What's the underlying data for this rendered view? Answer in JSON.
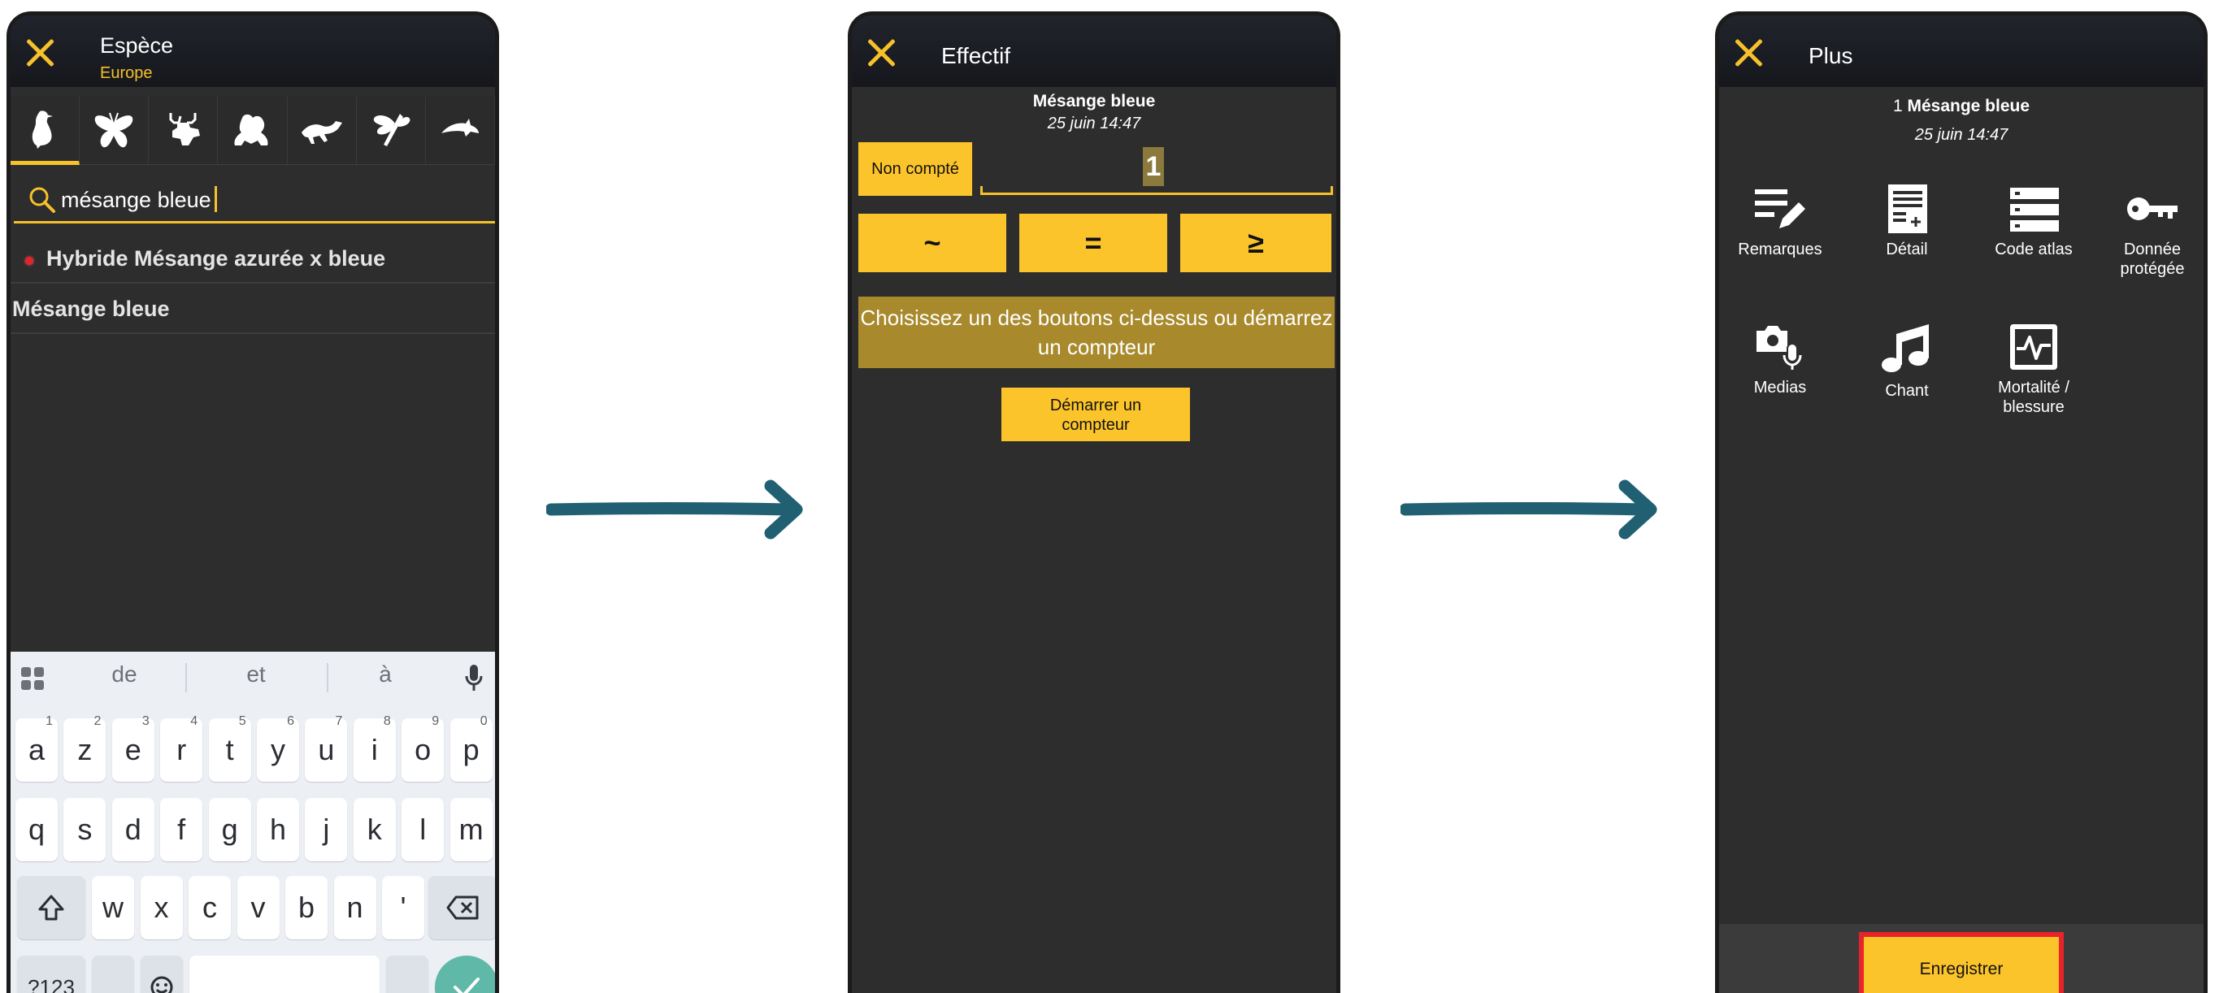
{
  "panel1": {
    "title": "Espèce",
    "subtitle": "Europe",
    "groups": [
      {
        "icon": "bird-icon"
      },
      {
        "icon": "butterfly-icon"
      },
      {
        "icon": "deer-icon"
      },
      {
        "icon": "frog-icon"
      },
      {
        "icon": "lizard-icon"
      },
      {
        "icon": "dragonfly-icon"
      },
      {
        "icon": "dolphin-icon"
      }
    ],
    "search_value": "mésange bleue",
    "results": [
      {
        "label": "Hybride Mésange azurée x bleue",
        "marker": true
      },
      {
        "label": "Mésange bleue",
        "marker": false
      }
    ],
    "keyboard": {
      "suggestions": [
        "de",
        "et",
        "à"
      ],
      "row1": [
        {
          "k": "a",
          "n": "1"
        },
        {
          "k": "z",
          "n": "2"
        },
        {
          "k": "e",
          "n": "3"
        },
        {
          "k": "r",
          "n": "4"
        },
        {
          "k": "t",
          "n": "5"
        },
        {
          "k": "y",
          "n": "6"
        },
        {
          "k": "u",
          "n": "7"
        },
        {
          "k": "i",
          "n": "8"
        },
        {
          "k": "o",
          "n": "9"
        },
        {
          "k": "p",
          "n": "0"
        }
      ],
      "row2": [
        "q",
        "s",
        "d",
        "f",
        "g",
        "h",
        "j",
        "k",
        "l",
        "m"
      ],
      "row3": [
        "w",
        "x",
        "c",
        "v",
        "b",
        "n",
        "'"
      ],
      "symbols_key": "?123",
      "comma_key": ",",
      "period_key": "."
    }
  },
  "panel2": {
    "title": "Effectif",
    "species": "Mésange bleue",
    "date": "25 juin 14:47",
    "not_counted": "Non compté",
    "count": "1",
    "precision": [
      "~",
      "=",
      "≥"
    ],
    "hint": "Choisissez un des boutons ci-dessus ou démarrez un compteur",
    "start_counter": "Démarrer un compteur"
  },
  "panel3": {
    "title": "Plus",
    "count": "1",
    "species": "Mésange bleue",
    "date": "25 juin 14:47",
    "tiles": [
      {
        "label": "Remarques",
        "icon": "notes-edit-icon"
      },
      {
        "label": "Détail",
        "icon": "detail-document-icon"
      },
      {
        "label": "Code atlas",
        "icon": "atlas-list-icon"
      },
      {
        "label": "Donnée protégée",
        "icon": "key-icon"
      },
      {
        "label": "Medias",
        "icon": "camera-mic-icon"
      },
      {
        "label": "Chant",
        "icon": "music-note-icon"
      },
      {
        "label": "Mortalité / blessure",
        "icon": "injury-pulse-icon"
      }
    ],
    "save": "Enregistrer"
  },
  "colors": {
    "accent": "#fcc42b",
    "background": "#2d2d2d",
    "arrow": "#215f73",
    "highlight": "#e8232b"
  }
}
